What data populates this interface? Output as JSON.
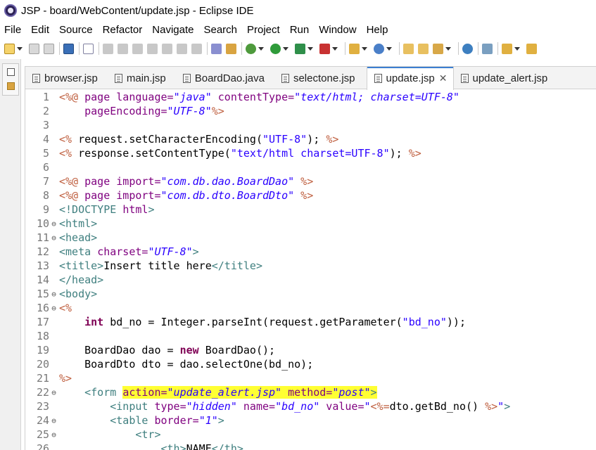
{
  "window": {
    "title": "JSP - board/WebContent/update.jsp - Eclipse IDE"
  },
  "menu": [
    "File",
    "Edit",
    "Source",
    "Refactor",
    "Navigate",
    "Search",
    "Project",
    "Run",
    "Window",
    "Help"
  ],
  "tabs": [
    {
      "label": "browser.jsp",
      "active": false
    },
    {
      "label": "main.jsp",
      "active": false
    },
    {
      "label": "BoardDao.java",
      "active": false
    },
    {
      "label": "selectone.jsp",
      "active": false
    },
    {
      "label": "update.jsp",
      "active": true
    },
    {
      "label": "update_alert.jsp",
      "active": false
    }
  ],
  "close_glyph": "✕",
  "code": {
    "lines": [
      {
        "n": "1",
        "fold": "",
        "segs": [
          [
            "dir",
            "<%@ "
          ],
          [
            "kw-plain",
            "page "
          ],
          [
            "attr",
            "language="
          ],
          [
            "str",
            "\"java\""
          ],
          [
            "attr",
            " contentType="
          ],
          [
            "str",
            "\"text/html; charset=UTF-8\""
          ]
        ]
      },
      {
        "n": "2",
        "fold": "",
        "segs": [
          [
            "plain",
            "    "
          ],
          [
            "attr",
            "pageEncoding="
          ],
          [
            "str",
            "\"UTF-8\""
          ],
          [
            "dir",
            "%>"
          ]
        ]
      },
      {
        "n": "3",
        "fold": "",
        "segs": []
      },
      {
        "n": "4",
        "fold": "",
        "segs": [
          [
            "dir",
            "<% "
          ],
          [
            "plain",
            "request.setCharacterEncoding("
          ],
          [
            "jstr",
            "\"UTF-8\""
          ],
          [
            "plain",
            "); "
          ],
          [
            "dir",
            "%>"
          ]
        ]
      },
      {
        "n": "5",
        "fold": "",
        "segs": [
          [
            "dir",
            "<% "
          ],
          [
            "plain",
            "response.setContentType("
          ],
          [
            "jstr",
            "\"text/html charset=UTF-8\""
          ],
          [
            "plain",
            "); "
          ],
          [
            "dir",
            "%>"
          ]
        ]
      },
      {
        "n": "6",
        "fold": "",
        "segs": []
      },
      {
        "n": "7",
        "fold": "",
        "segs": [
          [
            "dir",
            "<%@ "
          ],
          [
            "kw-plain",
            "page "
          ],
          [
            "attr",
            "import="
          ],
          [
            "str",
            "\"com.db.dao.BoardDao\""
          ],
          [
            "dir",
            " %>"
          ]
        ]
      },
      {
        "n": "8",
        "fold": "",
        "segs": [
          [
            "dir",
            "<%@ "
          ],
          [
            "kw-plain",
            "page "
          ],
          [
            "attr",
            "import="
          ],
          [
            "str",
            "\"com.db.dto.BoardDto\""
          ],
          [
            "dir",
            " %>"
          ]
        ]
      },
      {
        "n": "9",
        "fold": "",
        "segs": [
          [
            "tag",
            "<!DOCTYPE "
          ],
          [
            "kw-plain",
            "html"
          ],
          [
            "tag",
            ">"
          ]
        ]
      },
      {
        "n": "10",
        "fold": "⊖",
        "segs": [
          [
            "tag",
            "<html>"
          ]
        ]
      },
      {
        "n": "11",
        "fold": "⊖",
        "segs": [
          [
            "tag",
            "<head>"
          ]
        ]
      },
      {
        "n": "12",
        "fold": "",
        "segs": [
          [
            "tag",
            "<meta "
          ],
          [
            "attr",
            "charset="
          ],
          [
            "str",
            "\"UTF-8\""
          ],
          [
            "tag",
            ">"
          ]
        ]
      },
      {
        "n": "13",
        "fold": "",
        "segs": [
          [
            "tag",
            "<title>"
          ],
          [
            "plain",
            "Insert title here"
          ],
          [
            "tag",
            "</title>"
          ]
        ]
      },
      {
        "n": "14",
        "fold": "",
        "segs": [
          [
            "tag",
            "</head>"
          ]
        ]
      },
      {
        "n": "15",
        "fold": "⊖",
        "segs": [
          [
            "tag",
            "<body>"
          ]
        ]
      },
      {
        "n": "16",
        "fold": "⊖",
        "segs": [
          [
            "dir",
            "<%"
          ]
        ]
      },
      {
        "n": "17",
        "fold": "",
        "segs": [
          [
            "plain",
            "    "
          ],
          [
            "kw",
            "int"
          ],
          [
            "plain",
            " bd_no = Integer.parseInt(request.getParameter("
          ],
          [
            "jstr",
            "\"bd_no\""
          ],
          [
            "plain",
            "));"
          ]
        ]
      },
      {
        "n": "18",
        "fold": "",
        "segs": []
      },
      {
        "n": "19",
        "fold": "",
        "segs": [
          [
            "plain",
            "    BoardDao dao = "
          ],
          [
            "kw",
            "new"
          ],
          [
            "plain",
            " BoardDao();"
          ]
        ]
      },
      {
        "n": "20",
        "fold": "",
        "segs": [
          [
            "plain",
            "    BoardDto dto = dao.selectOne(bd_no);"
          ]
        ]
      },
      {
        "n": "21",
        "fold": "",
        "segs": [
          [
            "dir",
            "%>"
          ]
        ]
      },
      {
        "n": "22",
        "fold": "⊖",
        "segs": [
          [
            "plain",
            "    "
          ],
          [
            "tag",
            "<form "
          ],
          [
            "attr hl",
            "action="
          ],
          [
            "str hl",
            "\"update_alert.jsp\""
          ],
          [
            "attr hl",
            " method="
          ],
          [
            "str hl",
            "\"post\""
          ],
          [
            "tag hl",
            ">"
          ]
        ]
      },
      {
        "n": "23",
        "fold": "",
        "segs": [
          [
            "plain",
            "        "
          ],
          [
            "tag",
            "<input "
          ],
          [
            "attr",
            "type="
          ],
          [
            "str",
            "\"hidden\""
          ],
          [
            "attr",
            " name="
          ],
          [
            "str",
            "\"bd_no\""
          ],
          [
            "attr",
            " value="
          ],
          [
            "str",
            "\""
          ],
          [
            "dir",
            "<%="
          ],
          [
            "plain",
            "dto.getBd_no() "
          ],
          [
            "dir",
            "%>"
          ],
          [
            "str",
            "\""
          ],
          [
            "tag",
            ">"
          ]
        ]
      },
      {
        "n": "24",
        "fold": "⊖",
        "segs": [
          [
            "plain",
            "        "
          ],
          [
            "tag",
            "<table "
          ],
          [
            "attr",
            "border="
          ],
          [
            "str",
            "\"1\""
          ],
          [
            "tag",
            ">"
          ]
        ]
      },
      {
        "n": "25",
        "fold": "⊖",
        "segs": [
          [
            "plain",
            "            "
          ],
          [
            "tag",
            "<tr>"
          ]
        ]
      },
      {
        "n": "26",
        "fold": "",
        "segs": [
          [
            "plain",
            "                "
          ],
          [
            "tag",
            "<th>"
          ],
          [
            "plain",
            "NAME"
          ],
          [
            "tag",
            "</th>"
          ]
        ]
      }
    ]
  }
}
